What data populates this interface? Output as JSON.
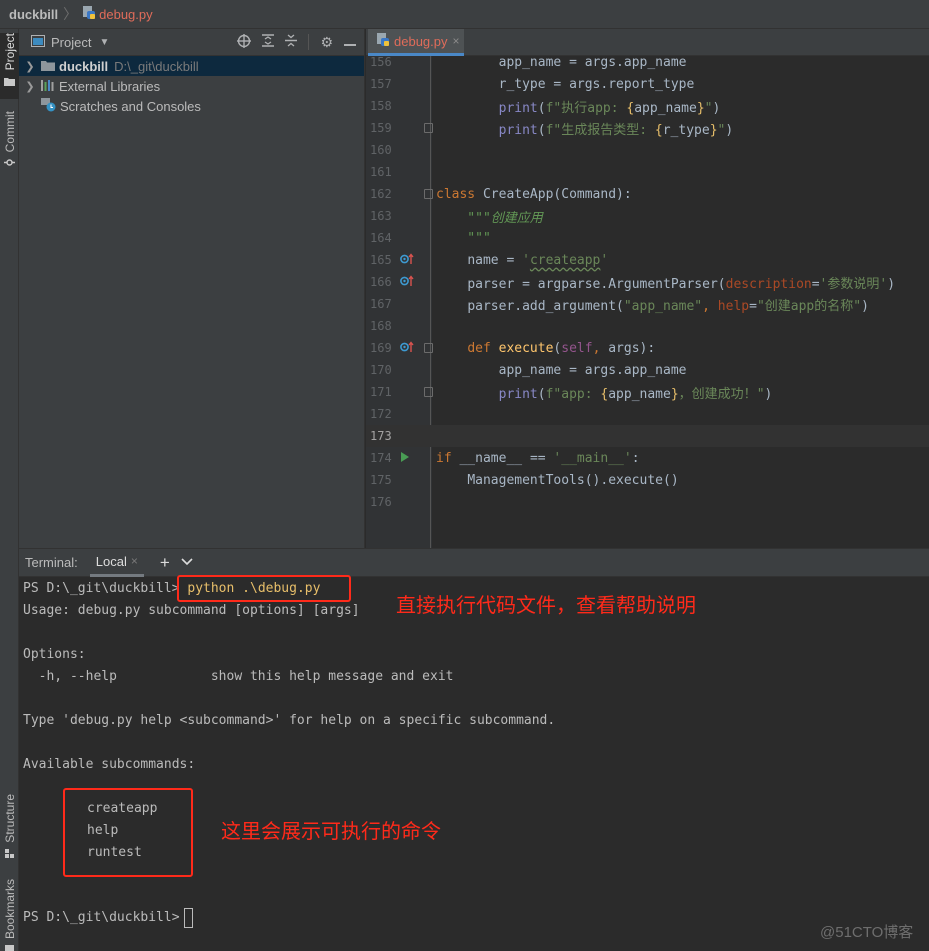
{
  "navbar": {
    "project": "duckbill",
    "file": "debug.py"
  },
  "left_strip": {
    "tabs": [
      {
        "label": "Project",
        "icon": "folder-icon"
      },
      {
        "label": "Commit",
        "icon": "commit-icon"
      },
      {
        "label": "Structure",
        "icon": "structure-icon"
      },
      {
        "label": "Bookmarks",
        "icon": "bookmark-icon"
      }
    ]
  },
  "project_panel": {
    "title": "Project",
    "toolbar_icons": [
      "locate-icon",
      "expand-all-icon",
      "collapse-all-icon",
      "gear-icon",
      "hide-icon"
    ],
    "tree": [
      {
        "label": "duckbill",
        "path": "D:\\_git\\duckbill",
        "icon": "folder-icon",
        "expandable": true,
        "selected": true
      },
      {
        "label": "External Libraries",
        "icon": "library-icon",
        "expandable": true,
        "selected": false
      },
      {
        "label": "Scratches and Consoles",
        "icon": "scratches-icon",
        "expandable": false,
        "selected": false
      }
    ]
  },
  "editor": {
    "tab": {
      "label": "debug.py",
      "close": "×"
    },
    "current_line": 173,
    "lines": [
      {
        "n": "156",
        "text": "        app_name = args.app_name"
      },
      {
        "n": "157",
        "text": "        r_type = args.report_type"
      },
      {
        "n": "158",
        "text": "        print(f\"执行app: {app_name}\")"
      },
      {
        "n": "159",
        "text": "        print(f\"生成报告类型: {r_type}\")"
      },
      {
        "n": "160",
        "text": ""
      },
      {
        "n": "161",
        "text": ""
      },
      {
        "n": "162",
        "text": "class CreateApp(Command):"
      },
      {
        "n": "163",
        "text": "    \"\"\"创建应用"
      },
      {
        "n": "164",
        "text": "    \"\"\""
      },
      {
        "n": "165",
        "text": "    name = 'createapp'"
      },
      {
        "n": "166",
        "text": "    parser = argparse.ArgumentParser(description='参数说明')"
      },
      {
        "n": "167",
        "text": "    parser.add_argument(\"app_name\", help=\"创建app的名称\")"
      },
      {
        "n": "168",
        "text": ""
      },
      {
        "n": "169",
        "text": "    def execute(self, args):"
      },
      {
        "n": "170",
        "text": "        app_name = args.app_name"
      },
      {
        "n": "171",
        "text": "        print(f\"app: {app_name}，创建成功！\")"
      },
      {
        "n": "172",
        "text": ""
      },
      {
        "n": "173",
        "text": ""
      },
      {
        "n": "174",
        "text": "if __name__ == '__main__':"
      },
      {
        "n": "175",
        "text": "    ManagementTools().execute()"
      },
      {
        "n": "176",
        "text": ""
      }
    ]
  },
  "terminal": {
    "label": "Terminal:",
    "tab": "Local",
    "tab_close": "×",
    "add": "+",
    "dropdown": "⌄",
    "prompt": "PS D:\\_git\\duckbill>",
    "command": "python .\\debug.py",
    "output": [
      "Usage: debug.py subcommand [options] [args]",
      "",
      "Options:",
      "  -h, --help            show this help message and exit",
      "",
      "Type 'debug.py help <subcommand>' for help on a specific subcommand.",
      "",
      "Available subcommands:",
      "",
      "    createapp",
      "    help",
      "    runtest",
      "",
      ""
    ],
    "subcommands": [
      "createapp",
      "help",
      "runtest"
    ],
    "final_prompt": "PS D:\\_git\\duckbill>"
  },
  "annotations": {
    "run_note": "直接执行代码文件，查看帮助说明",
    "commands_note": "这里会展示可执行的命令",
    "color": "#ff2a1a"
  },
  "watermark": "@51CTO博客"
}
